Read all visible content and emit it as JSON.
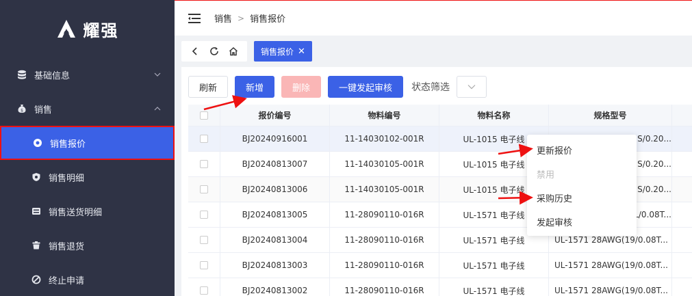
{
  "app": {
    "name": "耀强"
  },
  "sidebar": {
    "groups": [
      {
        "label": "基础信息",
        "icon": "database-icon",
        "expanded": false
      },
      {
        "label": "销售",
        "icon": "money-bag-icon",
        "expanded": true
      }
    ],
    "items": [
      {
        "label": "销售报价",
        "icon": "radio-dot-icon",
        "active": true
      },
      {
        "label": "销售明细",
        "icon": "shield-icon",
        "active": false
      },
      {
        "label": "销售送货明细",
        "icon": "list-box-icon",
        "active": false
      },
      {
        "label": "销售退货",
        "icon": "trash-icon",
        "active": false
      },
      {
        "label": "终止申请",
        "icon": "ban-icon",
        "active": false
      }
    ]
  },
  "header": {
    "breadcrumb": [
      "销售",
      "销售报价"
    ],
    "separator": ">"
  },
  "tabs": {
    "nav_icons": [
      "back-icon",
      "refresh-icon",
      "home-icon"
    ],
    "active_tab": {
      "label": "销售报价",
      "close": "✕"
    }
  },
  "toolbar": {
    "refresh_label": "刷新",
    "add_label": "新增",
    "delete_label": "删除",
    "submit_audit_label": "一键发起审核",
    "filter_label": "状态筛选"
  },
  "table": {
    "columns": [
      "报价编号",
      "物料编号",
      "物料名称",
      "规格型号"
    ],
    "rows": [
      [
        "BJ20240916001",
        "11-14030102-001R",
        "UL-1015 电子线",
        "S/0.20..."
      ],
      [
        "BJ20240813007",
        "11-14030105-001R",
        "UL-1015 电子线",
        "S/0.20..."
      ],
      [
        "BJ20240813006",
        "11-14030105-001R",
        "UL-1015 电子线",
        "S/0.20..."
      ],
      [
        "BJ20240813005",
        "11-28090110-016R",
        "UL-1571 电子线",
        "L/0.08T..."
      ],
      [
        "BJ20240813004",
        "11-28090110-016R",
        "UL-1571 电子线",
        "UL-1571 28AWG(19/0.08T..."
      ],
      [
        "BJ20240813003",
        "11-28090110-016R",
        "UL-1571 电子线",
        "UL-1571 28AWG(19/0.08T..."
      ],
      [
        "BJ20240813002",
        "11-28090110-016R",
        "UL-1571 电子线",
        "UL-1571 28AWG(19/0.08T..."
      ]
    ]
  },
  "context_menu": {
    "items": [
      {
        "label": "更新报价",
        "disabled": false
      },
      {
        "label": "禁用",
        "disabled": true
      },
      {
        "label": "采购历史",
        "disabled": false
      },
      {
        "label": "发起审核",
        "disabled": false
      }
    ]
  },
  "colors": {
    "sidebar_bg": "#2f3345",
    "primary": "#3b61e6",
    "annotation_red": "#e11"
  }
}
